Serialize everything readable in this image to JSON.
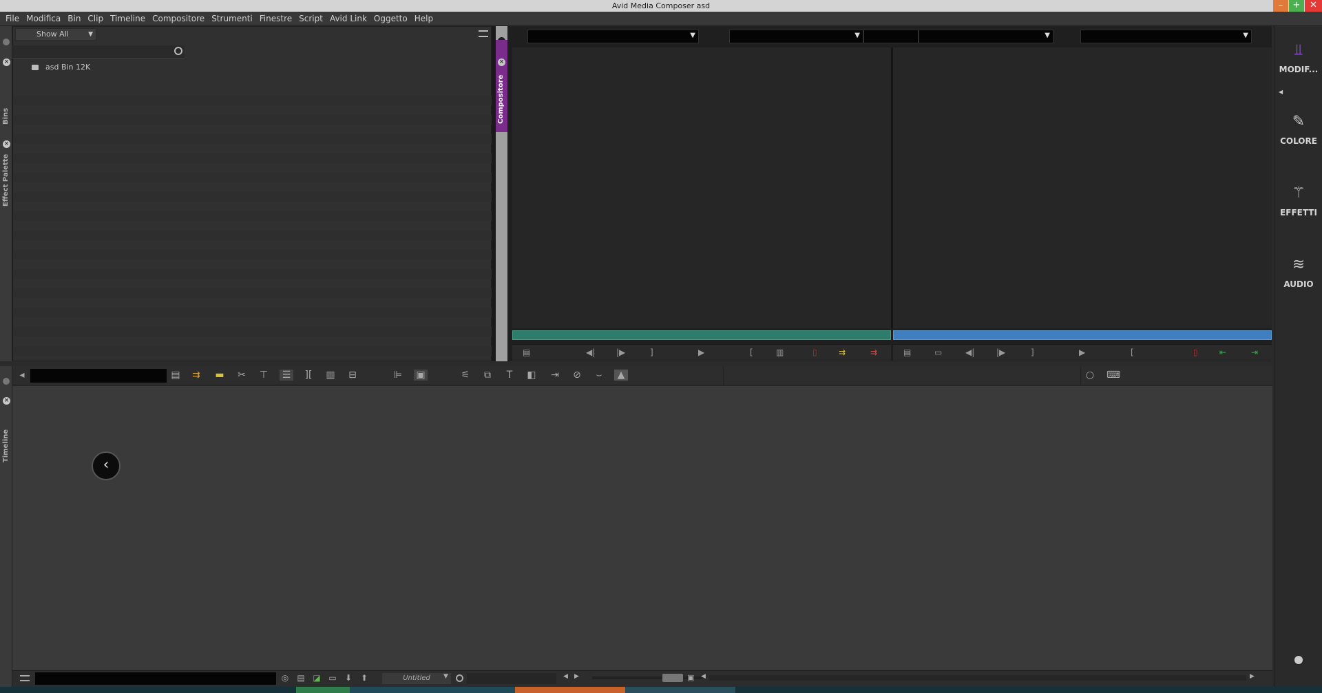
{
  "window": {
    "title": "Avid Media Composer  asd",
    "min_glyph": "–",
    "max_glyph": "+",
    "close_glyph": "✕"
  },
  "menu": [
    "File",
    "Modifica",
    "Bin",
    "Clip",
    "Timeline",
    "Compositore",
    "Strumenti",
    "Finestre",
    "Script",
    "Avid Link",
    "Oggetto",
    "Help"
  ],
  "left_tabs": {
    "bins": "Bins",
    "effect_palette": "Effect Palette",
    "timeline": "Timeline"
  },
  "bin_panel": {
    "filter_value": "Show All",
    "search_value": "",
    "items": [
      {
        "name": "asd Bin",
        "size": "12K"
      }
    ]
  },
  "compositore_tab": "Compositore",
  "composer": {
    "source_bar_color": "#2e7d6c",
    "record_bar_color": "#3f7fbf"
  },
  "right_panel": {
    "items": [
      {
        "label": "MODIF...",
        "icon": "modify-icon",
        "color": "#9b59e0"
      },
      {
        "label": "COLORE",
        "icon": "color-picker-icon",
        "color": "#d0d0d0"
      },
      {
        "label": "EFFETTI",
        "icon": "effects-wand-icon",
        "color": "#d0d0d0"
      },
      {
        "label": "AUDIO",
        "icon": "audio-waveform-icon",
        "color": "#d0d0d0"
      }
    ]
  },
  "timeline": {
    "sequence_name": "Untitled",
    "timecode": ""
  },
  "accent": {
    "purple": "#7a2c8b",
    "green": "#2e7d6c",
    "blue": "#3f7fbf",
    "orange": "#c8622a"
  }
}
